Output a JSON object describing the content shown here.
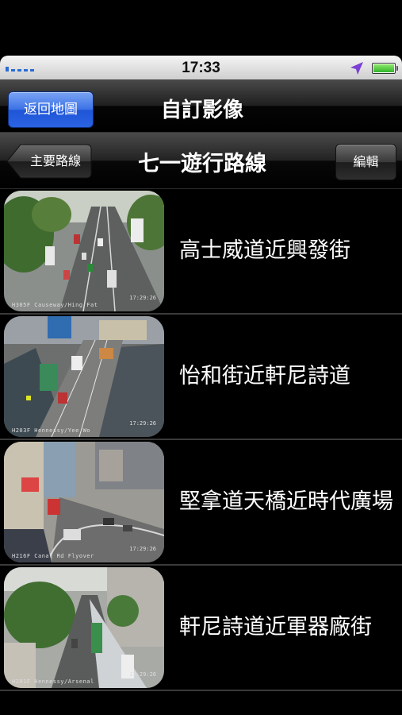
{
  "status_bar": {
    "time": "17:33",
    "battery_level": 1.0,
    "icons": [
      "signal-icon",
      "location-arrow-icon",
      "battery-icon"
    ]
  },
  "navbar": {
    "back_button": "返回地圖",
    "title": "自訂影像"
  },
  "toolbar": {
    "back_button": "主要路線",
    "title": "七一遊行路線",
    "edit_button": "編輯"
  },
  "cameras": [
    {
      "label": "高士威道近興發街",
      "caption": "H305F Causeway/Hing Fat",
      "time": "17:29:26"
    },
    {
      "label": "怡和街近軒尼詩道",
      "caption": "H203F Hennessy/Yee Wo",
      "time": "17:29:26"
    },
    {
      "label": "堅拿道天橋近時代廣場",
      "caption": "H216F Canal Rd Flyover",
      "time": "17:29:26"
    },
    {
      "label": "軒尼詩道近軍器廠街",
      "caption": "H201F Hennessy/Arsenal",
      "time": "17:29:26"
    }
  ],
  "colors": {
    "accent_blue": "#2a63e3",
    "background": "#000000"
  }
}
